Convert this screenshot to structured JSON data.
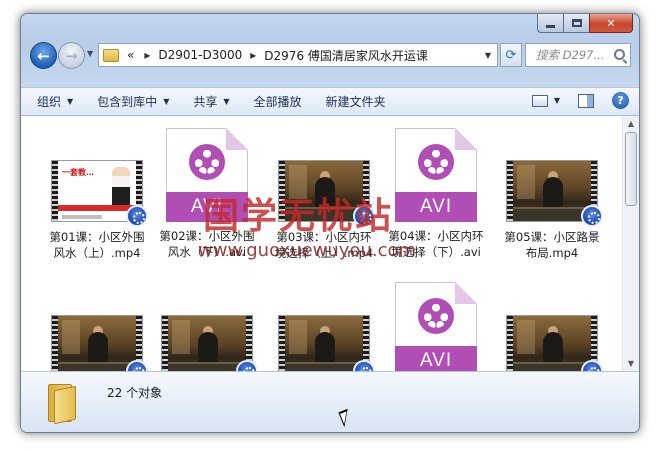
{
  "address": {
    "overflow": "«",
    "segments": [
      "D2901-D3000",
      "D2976 傅国清居家风水开运课"
    ]
  },
  "search": {
    "placeholder": "搜索 D297..."
  },
  "toolbar": {
    "organize": "组织",
    "include_library": "包含到库中",
    "share": "共享",
    "play_all": "全部播放",
    "new_folder": "新建文件夹"
  },
  "files": [
    {
      "name": "第01课：小区外围风水（上）.mp4",
      "type": "mp4-ad"
    },
    {
      "name": "第02课：小区外围风水（下）.avi",
      "type": "avi"
    },
    {
      "name": "第03课：小区内环境选择（上）.mp4",
      "type": "mp4"
    },
    {
      "name": "第04课：小区内环境选择（下）.avi",
      "type": "avi"
    },
    {
      "name": "第05课：小区路景布局.mp4",
      "type": "mp4"
    },
    {
      "name": "",
      "type": "mp4"
    },
    {
      "name": "",
      "type": "mp4"
    },
    {
      "name": "",
      "type": "mp4"
    },
    {
      "name": "",
      "type": "avi"
    },
    {
      "name": "",
      "type": "mp4"
    }
  ],
  "icons": {
    "avi_label": "AVI",
    "ad_banner": "一套教…"
  },
  "status": {
    "count": "22 个对象"
  },
  "watermark": {
    "chinese": "国学无忧站",
    "url": "www.guoxuewuyou.com"
  },
  "colors": {
    "avi_purple": "#b04eb5",
    "watermark_red": "#c42828"
  }
}
